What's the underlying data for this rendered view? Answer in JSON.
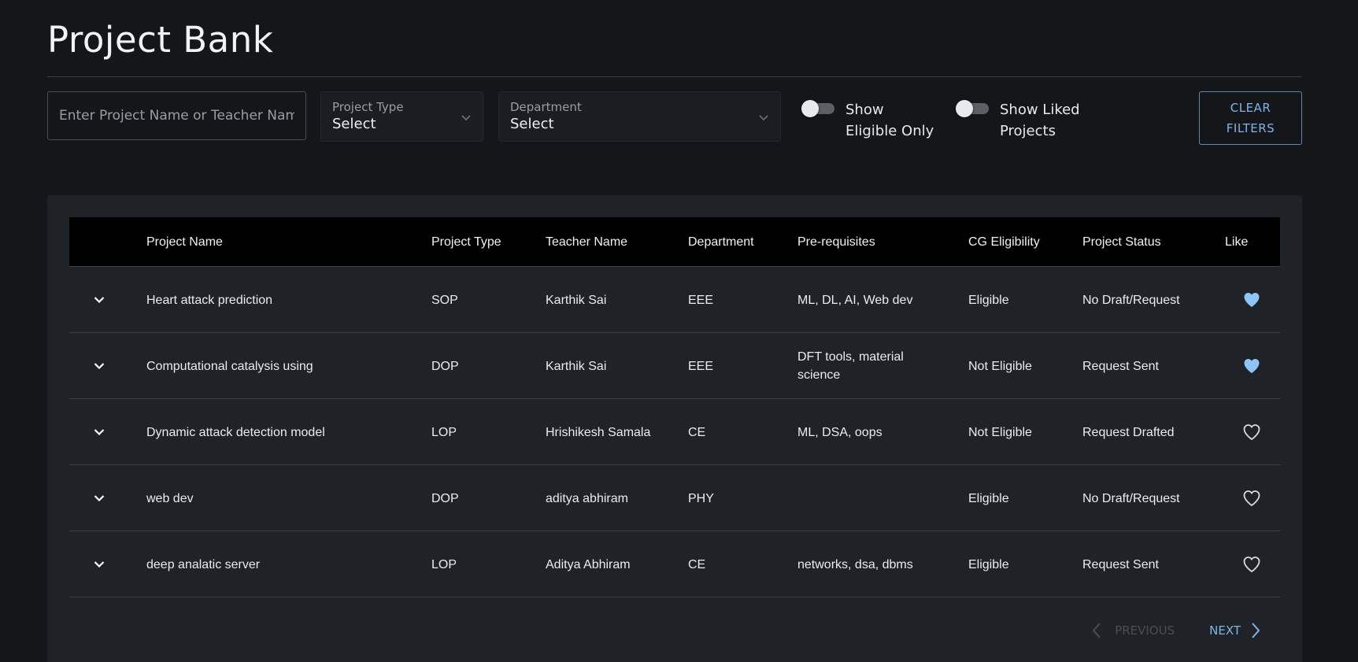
{
  "page": {
    "title": "Project Bank"
  },
  "filters": {
    "search_placeholder": "Enter Project Name or Teacher Name",
    "project_type": {
      "label": "Project Type",
      "value": "Select"
    },
    "department": {
      "label": "Department",
      "value": "Select"
    },
    "show_eligible": {
      "label": "Show Eligible Only",
      "checked": false
    },
    "show_liked": {
      "label": "Show Liked Projects",
      "checked": false
    },
    "clear_label": "CLEAR FILTERS"
  },
  "table": {
    "headers": {
      "name": "Project Name",
      "type": "Project Type",
      "teacher": "Teacher Name",
      "department": "Department",
      "prereq": "Pre-requisites",
      "cg": "CG Eligibility",
      "status": "Project Status",
      "like": "Like"
    },
    "rows": [
      {
        "name": "Heart attack prediction",
        "type": "SOP",
        "teacher": "Karthik Sai",
        "department": "EEE",
        "prereq": "ML, DL, AI, Web dev",
        "cg": "Eligible",
        "status": "No Draft/Request",
        "liked": true
      },
      {
        "name": "Computational catalysis using",
        "type": "DOP",
        "teacher": "Karthik Sai",
        "department": "EEE",
        "prereq": "DFT tools, material science",
        "cg": "Not Eligible",
        "status": "Request Sent",
        "liked": true
      },
      {
        "name": "Dynamic attack detection model",
        "type": "LOP",
        "teacher": "Hrishikesh Samala",
        "department": "CE",
        "prereq": "ML, DSA, oops",
        "cg": "Not Eligible",
        "status": "Request Drafted",
        "liked": false
      },
      {
        "name": "web dev",
        "type": "DOP",
        "teacher": "aditya abhiram",
        "department": "PHY",
        "prereq": "",
        "cg": "Eligible",
        "status": "No Draft/Request",
        "liked": false
      },
      {
        "name": "deep analatic server",
        "type": "LOP",
        "teacher": "Aditya Abhiram",
        "department": "CE",
        "prereq": "networks, dsa, dbms",
        "cg": "Eligible",
        "status": "Request Sent",
        "liked": false
      }
    ]
  },
  "pagination": {
    "previous_label": "PREVIOUS",
    "next_label": "NEXT"
  },
  "colors": {
    "accent": "#7fb4ea",
    "liked_heart": "#8ec5f5",
    "background": "#141619",
    "card": "#1f2226"
  }
}
